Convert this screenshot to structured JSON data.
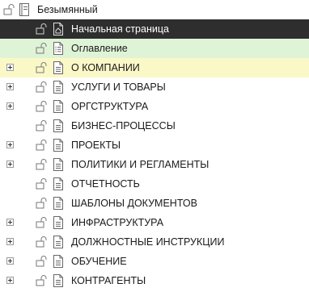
{
  "root": {
    "label": "Безымянный"
  },
  "items": [
    {
      "label": "Начальная страница",
      "state": "selected",
      "expander": false,
      "doc": "home"
    },
    {
      "label": "Оглавление",
      "state": "green",
      "expander": false,
      "doc": "list"
    },
    {
      "label": "О КОМПАНИИ",
      "state": "yellow",
      "expander": true,
      "doc": "page"
    },
    {
      "label": "УСЛУГИ И ТОВАРЫ",
      "state": "",
      "expander": true,
      "doc": "page"
    },
    {
      "label": "ОРГСТРУКТУРА",
      "state": "",
      "expander": true,
      "doc": "page"
    },
    {
      "label": "БИЗНЕС-ПРОЦЕССЫ",
      "state": "",
      "expander": false,
      "doc": "page"
    },
    {
      "label": "ПРОЕКТЫ",
      "state": "",
      "expander": true,
      "doc": "page"
    },
    {
      "label": "ПОЛИТИКИ И РЕГЛАМЕНТЫ",
      "state": "",
      "expander": true,
      "doc": "page"
    },
    {
      "label": "ОТЧЕТНОСТЬ",
      "state": "",
      "expander": false,
      "doc": "page"
    },
    {
      "label": "ШАБЛОНЫ ДОКУМЕНТОВ",
      "state": "",
      "expander": false,
      "doc": "page"
    },
    {
      "label": "ИНФРАСТРУКТУРА",
      "state": "",
      "expander": true,
      "doc": "page"
    },
    {
      "label": "ДОЛЖНОСТНЫЕ ИНСТРУКЦИИ",
      "state": "",
      "expander": true,
      "doc": "page"
    },
    {
      "label": "ОБУЧЕНИЕ",
      "state": "",
      "expander": true,
      "doc": "page"
    },
    {
      "label": "КОНТРАГЕНТЫ",
      "state": "",
      "expander": true,
      "doc": "page"
    }
  ],
  "colors": {
    "selected_bg": "#2e2e2e",
    "green_bg": "#dff3d6",
    "yellow_bg": "#fbf8c8"
  }
}
